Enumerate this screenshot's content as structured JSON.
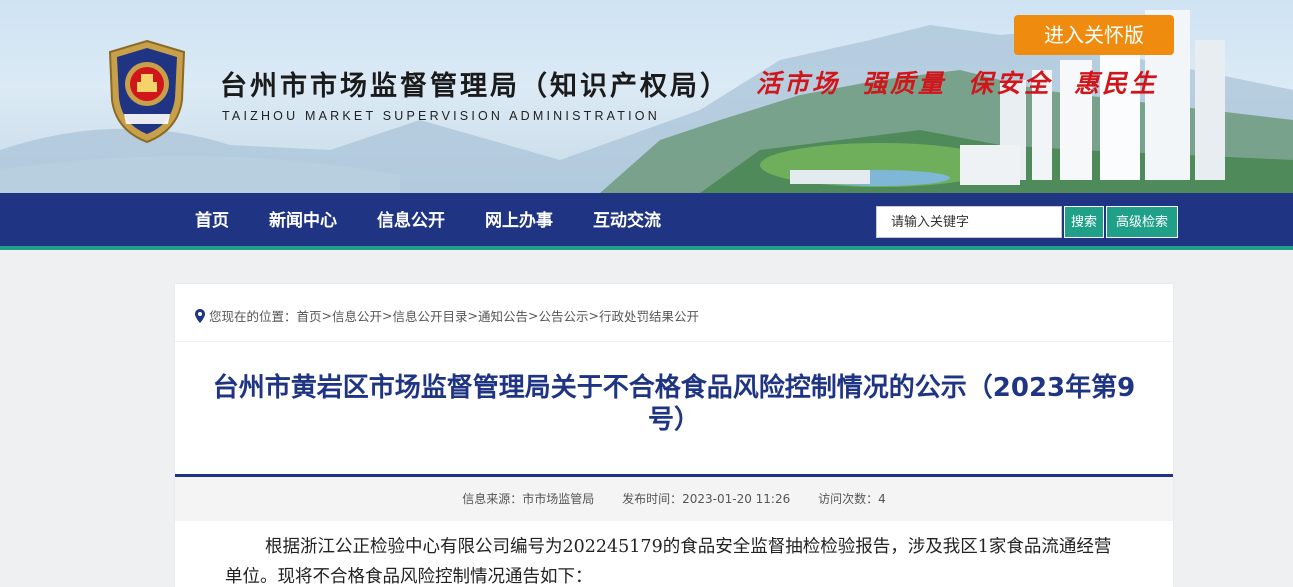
{
  "header": {
    "title_cn": "台州市市场监督管理局（知识产权局）",
    "title_en": "TAIZHOU MARKET SUPERVISION ADMINISTRATION",
    "emblem_text": "市场监督管理",
    "slogans": [
      "活市场",
      "强质量",
      "保安全",
      "惠民生"
    ],
    "care_button": "进入关怀版"
  },
  "nav": {
    "items": [
      "首页",
      "新闻中心",
      "信息公开",
      "网上办事",
      "互动交流"
    ],
    "search_placeholder": "请输入关键字",
    "search_button": "搜索",
    "advanced_search_button": "高级检索"
  },
  "breadcrumb": {
    "prefix": "您现在的位置：",
    "items": [
      "首页",
      "信息公开",
      "信息公开目录",
      "通知公告",
      "公告公示",
      "行政处罚结果公开"
    ],
    "separator": ">"
  },
  "article": {
    "title": "台州市黄岩区市场监督管理局关于不合格食品风险控制情况的公示（2023年第9号）",
    "source": "信息来源：市市场监管局",
    "publish_time": "发布时间：2023-01-20 11:26",
    "visits": "访问次数：4",
    "body": "根据浙江公正检验中心有限公司编号为202245179的食品安全监督抽检检验报告，涉及我区1家食品流通经营单位。现将不合格食品风险控制情况通告如下："
  },
  "colors": {
    "nav_bg": "#1f3483",
    "accent_green": "#21a089",
    "care_orange": "#ef8c0f",
    "slogan_red": "#d0161b",
    "title_blue": "#1f3483"
  },
  "icons": {
    "location": "location-pin-icon",
    "emblem": "police-emblem-icon"
  }
}
